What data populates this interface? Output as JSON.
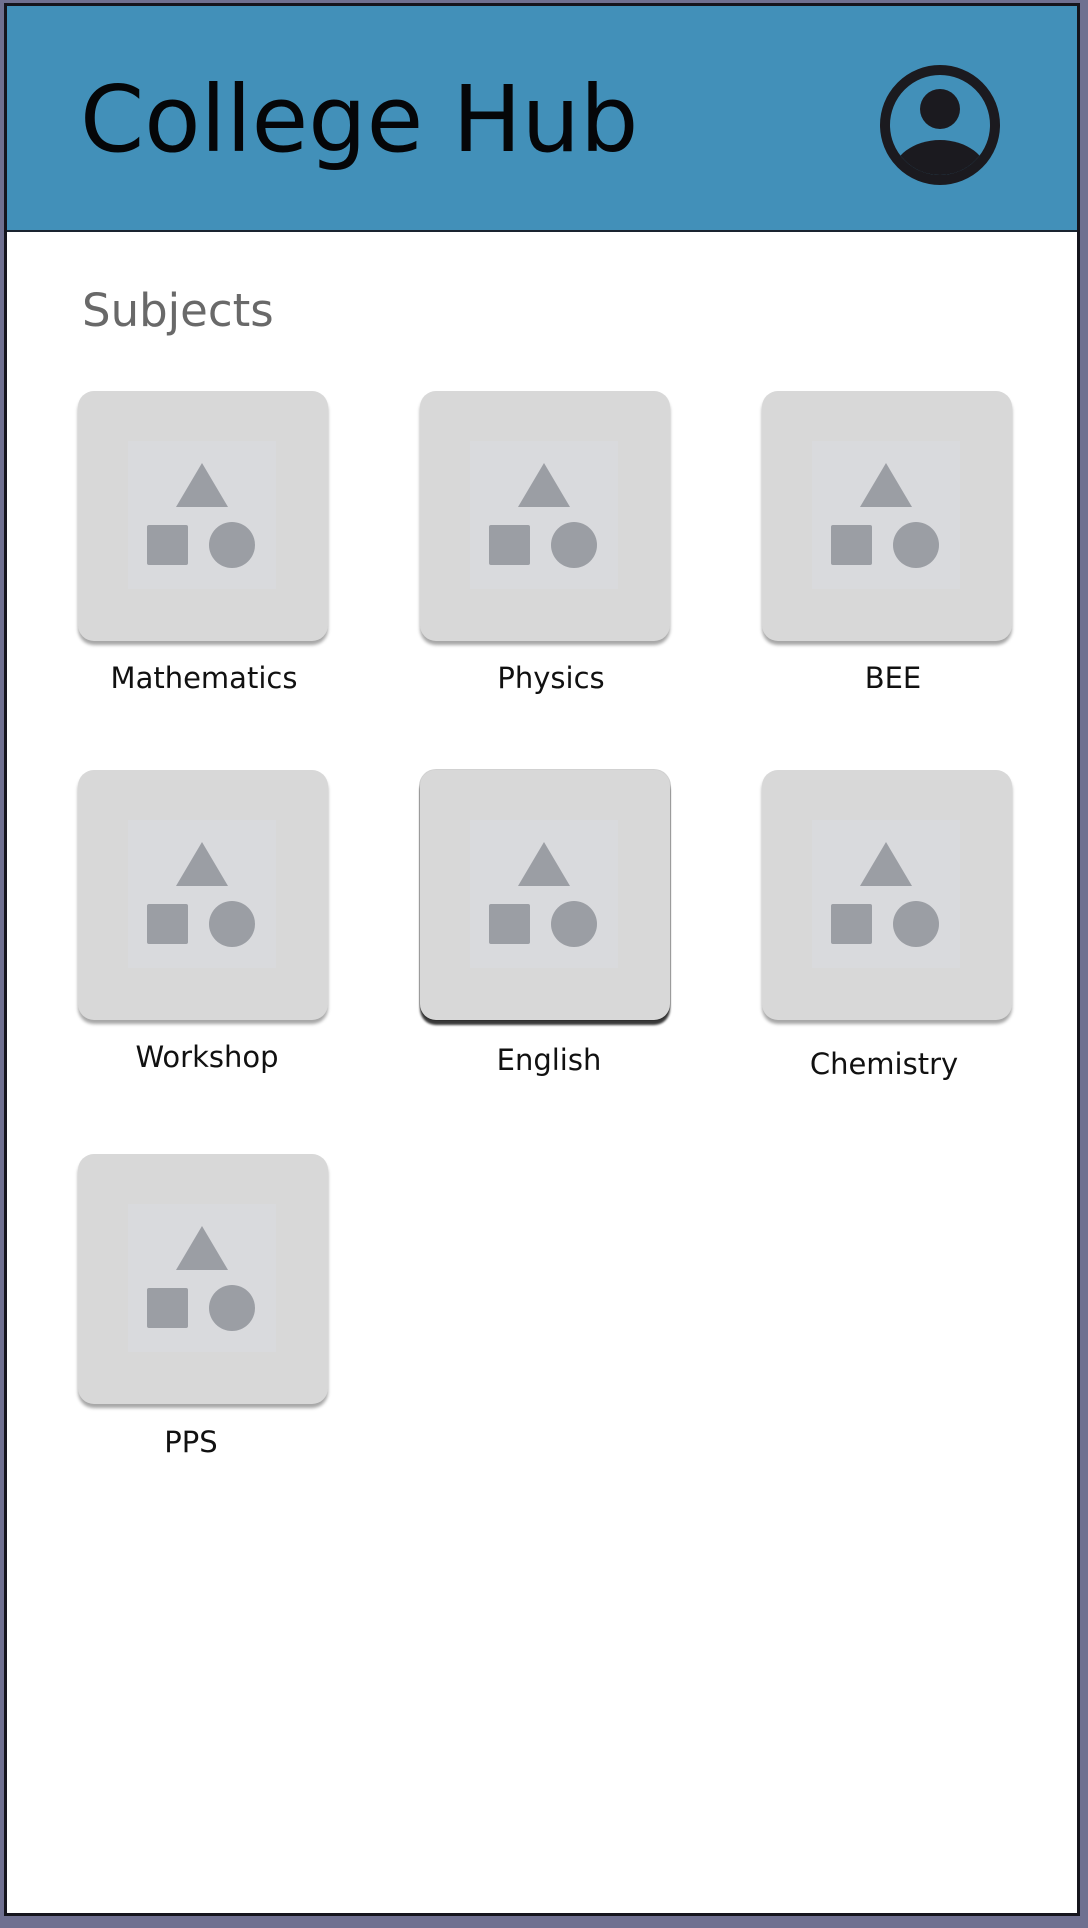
{
  "app": {
    "title": "College Hub"
  },
  "header": {
    "profile_icon": "account-circle-icon"
  },
  "subjects": {
    "heading": "Subjects",
    "placeholder_icon": "image-placeholder-icon",
    "items": [
      {
        "label": "Mathematics"
      },
      {
        "label": "Physics"
      },
      {
        "label": "BEE"
      },
      {
        "label": "Workshop"
      },
      {
        "label": "English"
      },
      {
        "label": "Chemistry"
      },
      {
        "label": "PPS"
      }
    ]
  },
  "colors": {
    "appbar": "#4290b9",
    "tile": "#d8d8d8",
    "placeholder_shapes": "#9b9ea4",
    "heading": "#696969"
  }
}
